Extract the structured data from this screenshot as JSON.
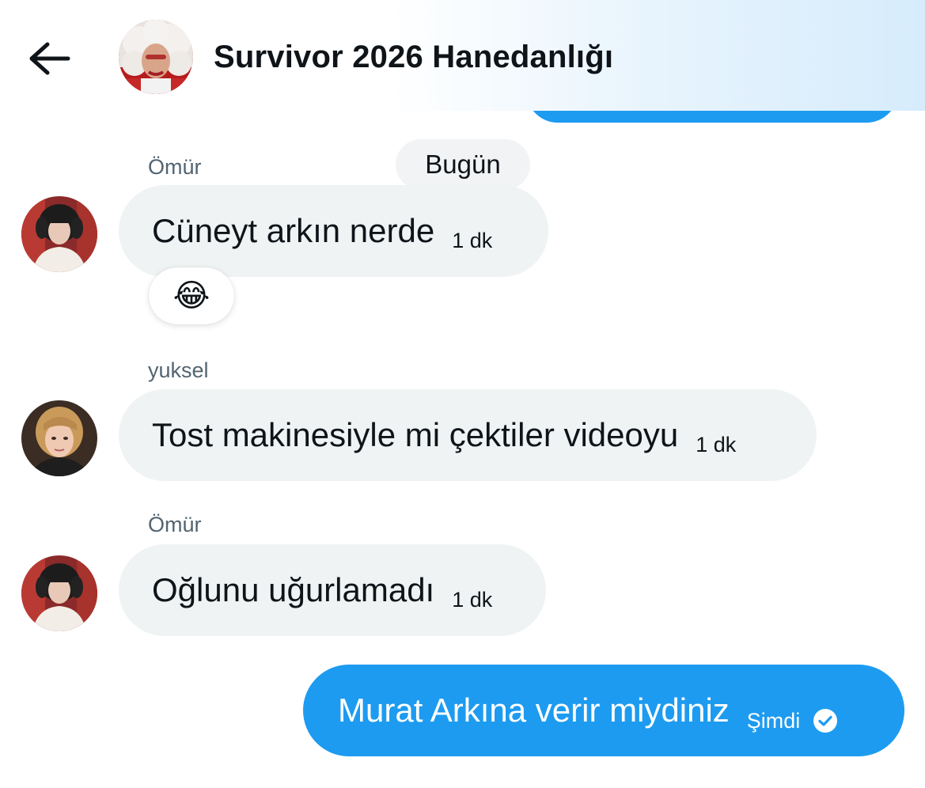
{
  "header": {
    "title": "Survivor 2026 Hanedanlığı",
    "back_icon": "arrow-left-icon"
  },
  "date_separator": "Bugün",
  "messages": [
    {
      "sender": "Ömür",
      "text": "Cüneyt arkın nerde",
      "time": "1 dk",
      "reaction": "😂"
    },
    {
      "sender": "yuksel",
      "text": "Tost makinesiyle mi çektiler videoyu",
      "time": "1 dk"
    },
    {
      "sender": "Ömür",
      "text": "Oğlunu uğurlamadı",
      "time": "1 dk"
    }
  ],
  "outgoing": {
    "text": "Murat Arkına verir miydiniz",
    "time": "Şimdi",
    "status_icon": "check-circle-icon"
  },
  "colors": {
    "accent": "#1d9bf0",
    "bubble_in": "#eff3f4",
    "secondary_text": "#536471"
  }
}
